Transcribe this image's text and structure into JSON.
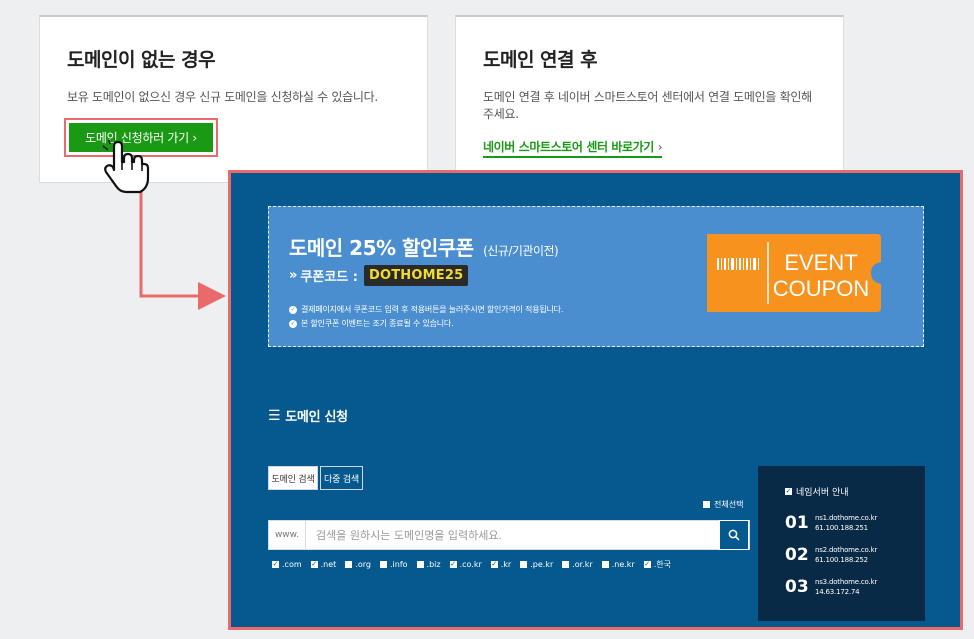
{
  "no_domain_card": {
    "title": "도메인이 없는 경우",
    "description": "보유 도메인이 없으신 경우 신규 도메인을 신청하실 수 있습니다.",
    "button_label": "도메인 신청하러 가기 ›"
  },
  "after_connect_card": {
    "title": "도메인 연결 후",
    "description": "도메인 연결 후 네이버 스마트스토어 센터에서 연결 도메인을 확인해 주세요.",
    "link_label": "네이버 스마트스토어 센터 바로가기",
    "link_chevron": "›"
  },
  "coupon": {
    "title": "도메인 25% 할인쿠폰",
    "subtitle": "(신규/기관이전)",
    "code_prefix": "»",
    "code_label": "쿠폰코드 :",
    "code": "DOTHOME25",
    "notes": [
      "결제페이지에서 쿠폰코드 입력 후 적용버튼을 눌러주시면 할인가격이 적용됩니다.",
      "본 할인쿠폰 이벤트는 조기 종료될 수 있습니다."
    ],
    "ticket_line1": "EVENT",
    "ticket_line2": "COUPON"
  },
  "domain_apply": {
    "section_title": "도메인 신청",
    "tabs": [
      "도메인 검색",
      "다중 검색"
    ],
    "select_all_label": "전체선택",
    "search_prefix": "www.",
    "search_placeholder": "검색을 원하시는 도메인명을 입력하세요.",
    "tlds": [
      {
        "label": ".com",
        "checked": true
      },
      {
        "label": ".net",
        "checked": true
      },
      {
        "label": ".org",
        "checked": false
      },
      {
        "label": ".info",
        "checked": false
      },
      {
        "label": ".biz",
        "checked": false
      },
      {
        "label": ".co.kr",
        "checked": true
      },
      {
        "label": ".kr",
        "checked": true
      },
      {
        "label": ".pe.kr",
        "checked": false
      },
      {
        "label": ".or.kr",
        "checked": false
      },
      {
        "label": ".ne.kr",
        "checked": false
      },
      {
        "label": ".한국",
        "checked": true
      }
    ]
  },
  "nameservers": {
    "title": "네임서버 안내",
    "items": [
      {
        "num": "01",
        "host": "ns1.dothome.co.kr",
        "ip": "61.100.188.251"
      },
      {
        "num": "02",
        "host": "ns2.dothome.co.kr",
        "ip": "61.100.188.252"
      },
      {
        "num": "03",
        "host": "ns3.dothome.co.kr",
        "ip": "14.63.172.74"
      }
    ]
  },
  "colors": {
    "brand_green": "#1a9a14",
    "highlight_red": "#e96a6a",
    "panel_blue": "#05598f",
    "coupon_blue": "#4a8ed0",
    "ticket_orange": "#f7921e",
    "ns_navy": "#082a47",
    "code_yellow": "#f4dc2a"
  },
  "icons": [
    "pointing-hand-icon",
    "arrow-connector-icon",
    "menu-icon",
    "search-icon",
    "check-circle-icon",
    "barcode-icon",
    "checkbox-icon"
  ]
}
